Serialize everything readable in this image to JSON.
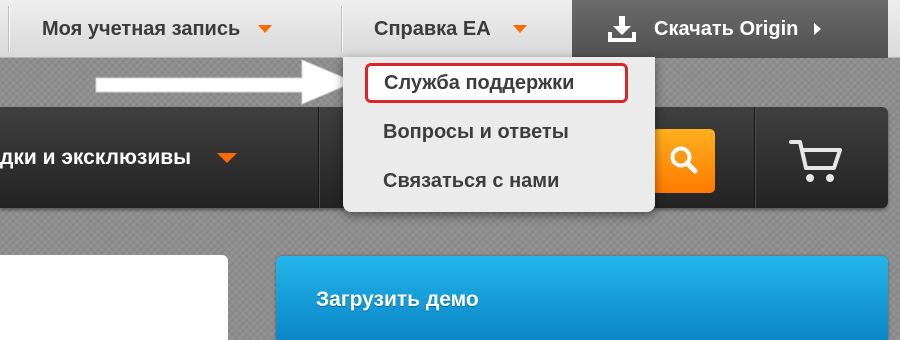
{
  "topbar": {
    "account_label": "Моя учетная запись",
    "help_label": "Справка EA",
    "download_label": "Скачать Origin"
  },
  "help_menu": {
    "items": [
      {
        "label": "Служба поддержки",
        "highlighted": true
      },
      {
        "label": "Вопросы и ответы",
        "highlighted": false
      },
      {
        "label": "Связаться с нами",
        "highlighted": false
      }
    ]
  },
  "category_bar": {
    "deals_label": "дки и эксклюзивы"
  },
  "promo": {
    "demo_label": "Загрузить демо"
  },
  "colors": {
    "accent": "#ff6a00",
    "highlight_border": "#d9262c",
    "promo_blue": "#1a9fd9",
    "download_bg": "#5c5c5c"
  },
  "icons": {
    "download": "download-tray-icon",
    "chevron": "chevron-right-icon",
    "search": "magnifier-icon",
    "cart": "shopping-cart-icon"
  }
}
